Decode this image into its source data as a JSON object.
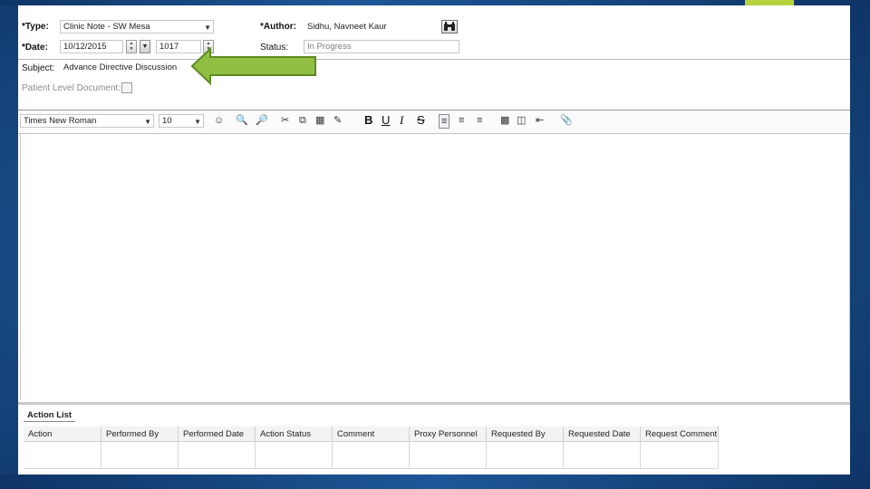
{
  "theme": {
    "accent": "#b6d23d",
    "arrow_fill": "#8fc043",
    "arrow_stroke": "#5e8a22",
    "slide_bg": "#174a84"
  },
  "form": {
    "type_label": "*Type:",
    "type_value": "Clinic Note - SW Mesa",
    "author_label": "*Author:",
    "author_value": "Sidhu, Navneet Kaur",
    "date_label": "*Date:",
    "date_value": "10/12/2015",
    "time_value": "1017",
    "status_label": "Status:",
    "status_value": "In Progress",
    "subject_label": "Subject:",
    "subject_value": "Advance Directive Discussion",
    "patient_level_label": "Patient Level Document:"
  },
  "toolbar": {
    "font_name": "Times New Roman",
    "font_size": "10",
    "bold": "B",
    "underline": "U",
    "italic": "I",
    "strike": "S",
    "icons": [
      "spellcheck-icon",
      "zoom-in-icon",
      "zoom-out-icon",
      "cut-icon",
      "copy-icon",
      "paste-icon",
      "format-painter-icon",
      "align-left-icon",
      "align-center-icon",
      "align-right-icon",
      "stamp-icon",
      "insert-field-icon",
      "indent-icon",
      "attachment-icon"
    ]
  },
  "action_list": {
    "tab_label": "Action List",
    "columns": [
      "Action",
      "Performed By",
      "Performed Date",
      "Action Status",
      "Comment",
      "Proxy Personnel",
      "Requested By",
      "Requested Date",
      "Request Comment"
    ]
  }
}
